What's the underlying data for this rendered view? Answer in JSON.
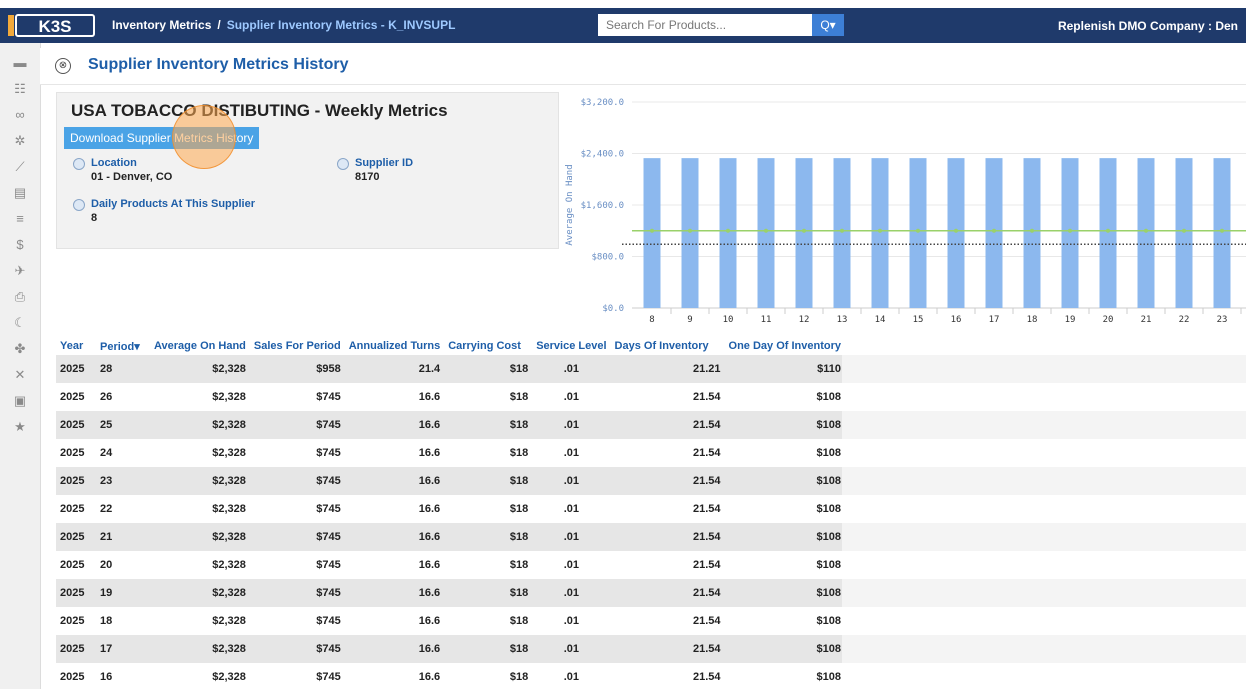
{
  "app": {
    "logo_text": "K3S",
    "breadcrumb": {
      "parent": "Inventory Metrics",
      "separator": "/",
      "current": "Supplier Inventory Metrics - K_INVSUPL"
    },
    "search": {
      "placeholder": "Search For Products...",
      "button_label": "Q"
    },
    "company": "Replenish DMO Company : Den"
  },
  "page": {
    "title": "Supplier Inventory Metrics History",
    "close_symbol": "⊗"
  },
  "card": {
    "heading": "USA TOBACCO DISTIBUTING - Weekly Metrics",
    "download_label": "Download Supplier Metrics History",
    "location_label": "Location",
    "location_value": "01 - Denver, CO",
    "supplier_id_label": "Supplier ID",
    "supplier_id_value": "8170",
    "daily_products_label": "Daily Products At This Supplier",
    "daily_products_value": "8"
  },
  "sidebar_icons": [
    "monitor-icon",
    "users-icon",
    "link-icon",
    "gear-icon",
    "line-chart-icon",
    "id-card-icon",
    "database-icon",
    "dollar-icon",
    "plane-icon",
    "printer-icon",
    "moon-icon",
    "paw-icon",
    "tools-icon",
    "briefcase-icon",
    "star-icon"
  ],
  "chart_data": {
    "type": "bar",
    "ylabel": "Average On Hand",
    "yticks": [
      "$0.0",
      "$800.0",
      "$1,600.0",
      "$2,400.0",
      "$3,200.0"
    ],
    "ylim": [
      0,
      3200
    ],
    "categories": [
      "8",
      "9",
      "10",
      "11",
      "12",
      "13",
      "14",
      "15",
      "16",
      "17",
      "18",
      "19",
      "20",
      "21",
      "22",
      "23"
    ],
    "series": [
      {
        "kind": "bar",
        "values": [
          2328,
          2328,
          2328,
          2328,
          2328,
          2328,
          2328,
          2328,
          2328,
          2328,
          2328,
          2328,
          2328,
          2328,
          2328,
          2328
        ]
      },
      {
        "kind": "line",
        "values": [
          1200,
          1200,
          1200,
          1200,
          1200,
          1200,
          1200,
          1200,
          1200,
          1200,
          1200,
          1200,
          1200,
          1200,
          1200,
          1200
        ]
      },
      {
        "kind": "dotted-line",
        "values": [
          990,
          990,
          990,
          990,
          990,
          990,
          990,
          990,
          990,
          990,
          990,
          990,
          990,
          990,
          990,
          990
        ]
      }
    ],
    "colors": {
      "bar": "#8cb8ee",
      "line": "#9ad16a",
      "dotted": "#444444"
    },
    "grid": true
  },
  "table": {
    "columns": [
      "Year",
      "Period",
      "Average On Hand",
      "Sales For Period",
      "Annualized Turns",
      "Carrying Cost",
      "Service Level",
      "Days Of Inventory",
      "One Day Of Inventory"
    ],
    "sort_indicator": "▾",
    "rows": [
      [
        "2025",
        "28",
        "$2,328",
        "$958",
        "21.4",
        "$18",
        ".01",
        "21.21",
        "$110"
      ],
      [
        "2025",
        "26",
        "$2,328",
        "$745",
        "16.6",
        "$18",
        ".01",
        "21.54",
        "$108"
      ],
      [
        "2025",
        "25",
        "$2,328",
        "$745",
        "16.6",
        "$18",
        ".01",
        "21.54",
        "$108"
      ],
      [
        "2025",
        "24",
        "$2,328",
        "$745",
        "16.6",
        "$18",
        ".01",
        "21.54",
        "$108"
      ],
      [
        "2025",
        "23",
        "$2,328",
        "$745",
        "16.6",
        "$18",
        ".01",
        "21.54",
        "$108"
      ],
      [
        "2025",
        "22",
        "$2,328",
        "$745",
        "16.6",
        "$18",
        ".01",
        "21.54",
        "$108"
      ],
      [
        "2025",
        "21",
        "$2,328",
        "$745",
        "16.6",
        "$18",
        ".01",
        "21.54",
        "$108"
      ],
      [
        "2025",
        "20",
        "$2,328",
        "$745",
        "16.6",
        "$18",
        ".01",
        "21.54",
        "$108"
      ],
      [
        "2025",
        "19",
        "$2,328",
        "$745",
        "16.6",
        "$18",
        ".01",
        "21.54",
        "$108"
      ],
      [
        "2025",
        "18",
        "$2,328",
        "$745",
        "16.6",
        "$18",
        ".01",
        "21.54",
        "$108"
      ],
      [
        "2025",
        "17",
        "$2,328",
        "$745",
        "16.6",
        "$18",
        ".01",
        "21.54",
        "$108"
      ],
      [
        "2025",
        "16",
        "$2,328",
        "$745",
        "16.6",
        "$18",
        ".01",
        "21.54",
        "$108"
      ]
    ]
  }
}
